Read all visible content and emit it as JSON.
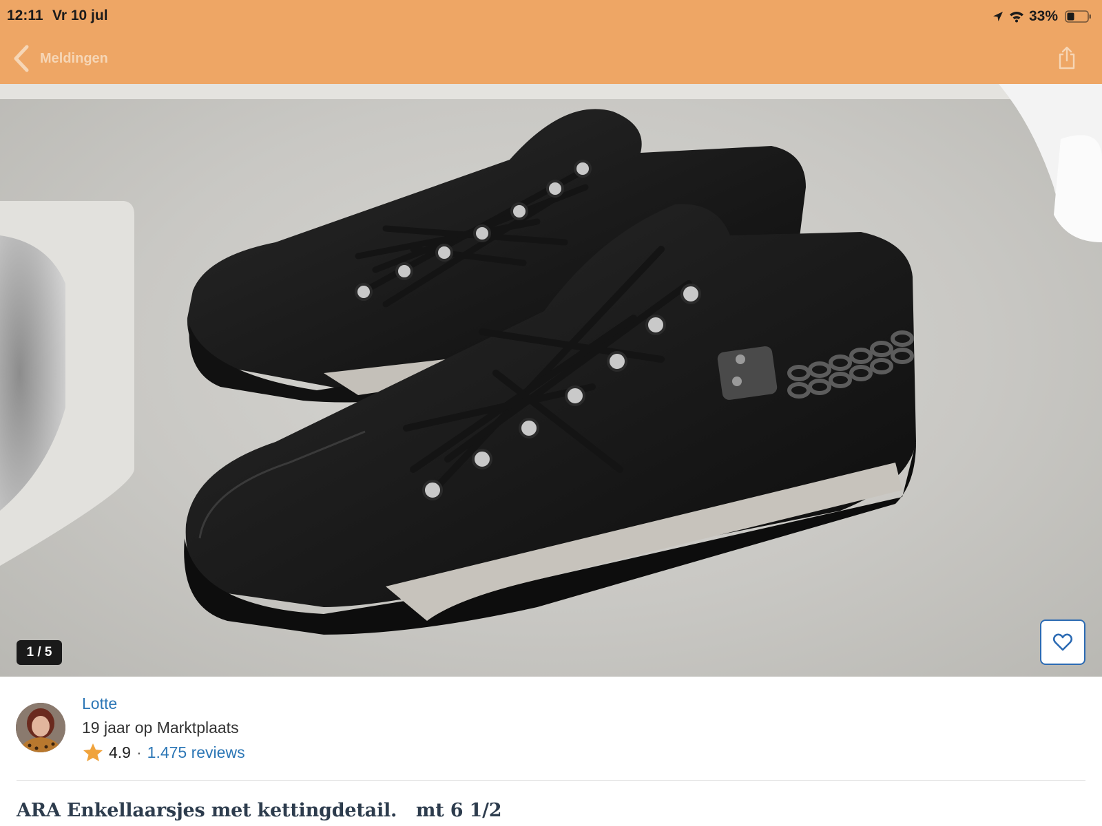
{
  "status_bar": {
    "time": "12:11",
    "date": "Vr 10 jul",
    "battery": "33%",
    "icons": [
      "location-arrow-icon",
      "wifi-icon",
      "battery-icon"
    ]
  },
  "nav": {
    "back_label": "Meldingen",
    "back_icon": "chevron-left-icon",
    "share_icon": "share-icon"
  },
  "colors": {
    "header": "#eea665",
    "link": "#2d77b6",
    "favorite_border": "#2b6ab3",
    "star": "#f0a33c"
  },
  "gallery": {
    "counter": "1 / 5",
    "favorite_icon": "heart-icon"
  },
  "seller": {
    "name": "Lotte",
    "membership": "19 jaar op Marktplaats",
    "rating": "4.9",
    "separator": "·",
    "reviews": "1.475 reviews",
    "rating_icon": "star-icon"
  },
  "listing": {
    "title": "ARA Enkellaarsjes met kettingdetail.   mt 6 1/2"
  }
}
